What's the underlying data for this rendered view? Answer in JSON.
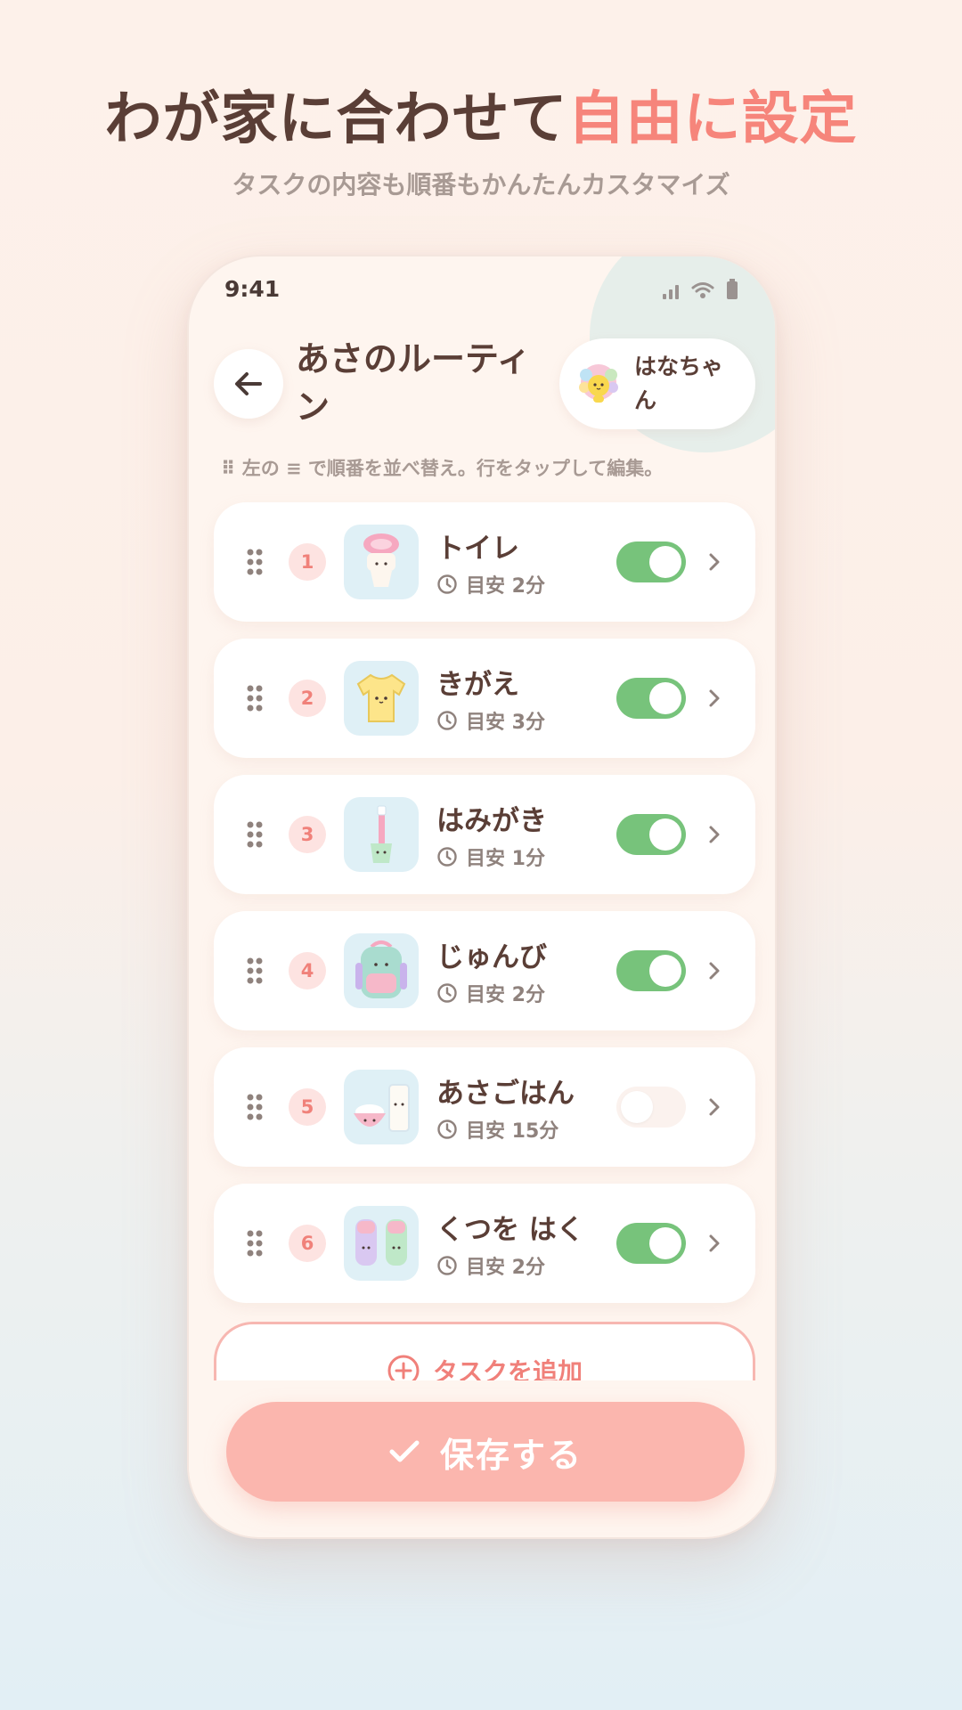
{
  "promo": {
    "headline_main": "わが家に合わせて",
    "headline_accent": "自由に設定",
    "subheadline": "タスクの内容も順番もかんたんカスタマイズ"
  },
  "status_bar": {
    "time": "9:41"
  },
  "header": {
    "title": "あさのルーティン",
    "profile_name": "はなちゃん"
  },
  "hint": "⠿ 左の ≡ で順番を並べ替え。行をタップして編集。",
  "tasks": [
    {
      "number": "1",
      "name": "トイレ",
      "time": "目安 2分",
      "enabled": true,
      "icon": "toilet-icon"
    },
    {
      "number": "2",
      "name": "きがえ",
      "time": "目安 3分",
      "enabled": true,
      "icon": "tshirt-icon"
    },
    {
      "number": "3",
      "name": "はみがき",
      "time": "目安 1分",
      "enabled": true,
      "icon": "toothbrush-icon"
    },
    {
      "number": "4",
      "name": "じゅんび",
      "time": "目安 2分",
      "enabled": true,
      "icon": "backpack-icon"
    },
    {
      "number": "5",
      "name": "あさごはん",
      "time": "目安 15分",
      "enabled": false,
      "icon": "breakfast-icon"
    },
    {
      "number": "6",
      "name": "くつを はく",
      "time": "目安 2分",
      "enabled": true,
      "icon": "shoes-icon"
    }
  ],
  "add_task_label": "タスクを追加",
  "save_label": "保存する",
  "colors": {
    "accent": "#f6857b",
    "toggle_on": "#77c37b",
    "save_button": "#fbb6ae",
    "text_primary": "#5a3e36"
  }
}
